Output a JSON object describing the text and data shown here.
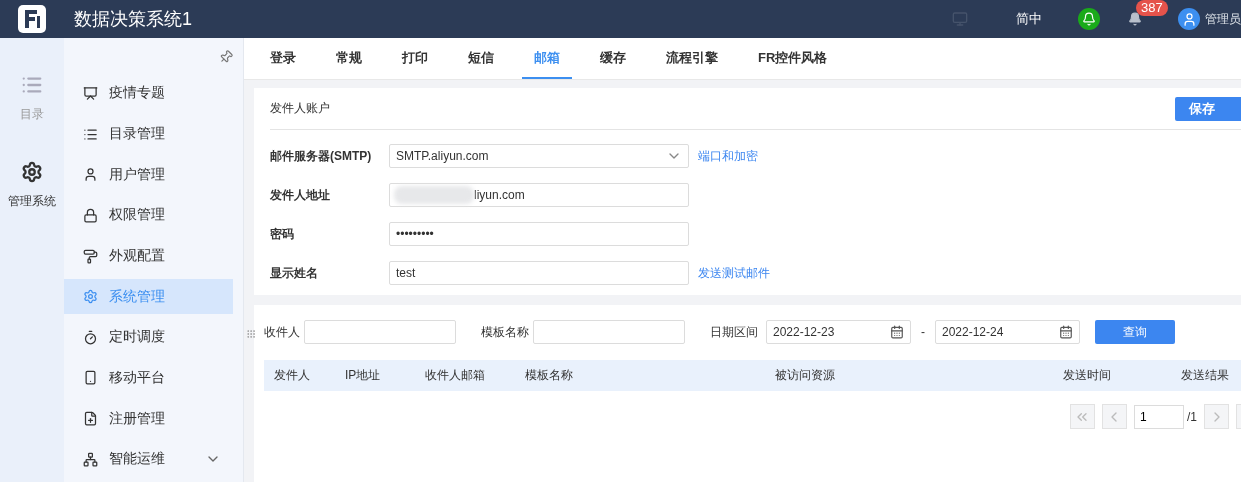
{
  "app": {
    "title": "数据决策系统1"
  },
  "header": {
    "language": "简中",
    "notification_count": "387",
    "user": "管理员"
  },
  "rail": [
    {
      "label": "目录",
      "selected": false
    },
    {
      "label": "管理系统",
      "selected": true
    }
  ],
  "sidebar": {
    "items": [
      {
        "label": "疫情专题",
        "kind": "link",
        "selected": false
      },
      {
        "label": "目录管理",
        "kind": "link",
        "selected": false
      },
      {
        "label": "用户管理",
        "kind": "link",
        "selected": false
      },
      {
        "label": "权限管理",
        "kind": "link",
        "selected": false
      },
      {
        "label": "外观配置",
        "kind": "link",
        "selected": false
      },
      {
        "label": "系统管理",
        "kind": "link",
        "selected": true
      },
      {
        "label": "定时调度",
        "kind": "link",
        "selected": false
      },
      {
        "label": "移动平台",
        "kind": "link",
        "selected": false
      },
      {
        "label": "注册管理",
        "kind": "link",
        "selected": false
      },
      {
        "label": "智能运维",
        "kind": "group",
        "expanded": false,
        "selected": false
      }
    ]
  },
  "tabs": [
    {
      "label": "登录",
      "selected": false
    },
    {
      "label": "常规",
      "selected": false
    },
    {
      "label": "打印",
      "selected": false
    },
    {
      "label": "短信",
      "selected": false
    },
    {
      "label": "邮箱",
      "selected": true
    },
    {
      "label": "缓存",
      "selected": false
    },
    {
      "label": "流程引擎",
      "selected": false
    },
    {
      "label": "FR控件风格",
      "selected": false
    }
  ],
  "sender_account": {
    "title": "发件人账户",
    "save_button": "保存",
    "fields": [
      {
        "label": "邮件服务器(SMTP)",
        "kind": "select",
        "value": "SMTP.aliyun.com",
        "link": "端口和加密"
      },
      {
        "label": "发件人地址",
        "kind": "redacted",
        "value": "liyun.com"
      },
      {
        "label": "密码",
        "kind": "text",
        "value": "•••••••••"
      },
      {
        "label": "显示姓名",
        "kind": "text",
        "value": "test",
        "link": "发送测试邮件"
      }
    ]
  },
  "mail_log": {
    "filters": [
      {
        "label": "收件人",
        "kind": "text"
      },
      {
        "label": "模板名称",
        "kind": "text"
      },
      {
        "label": "日期区间",
        "kind": "daterange",
        "from": "2022-12-23",
        "separator": "-",
        "to": "2022-12-24"
      }
    ],
    "query_button": "查询",
    "columns": [
      "发件人",
      "IP地址",
      "收件人邮箱",
      "模板名称",
      "被访问资源",
      "发送时间",
      "发送结果"
    ],
    "pager": {
      "page": "1",
      "total": "/1"
    }
  }
}
